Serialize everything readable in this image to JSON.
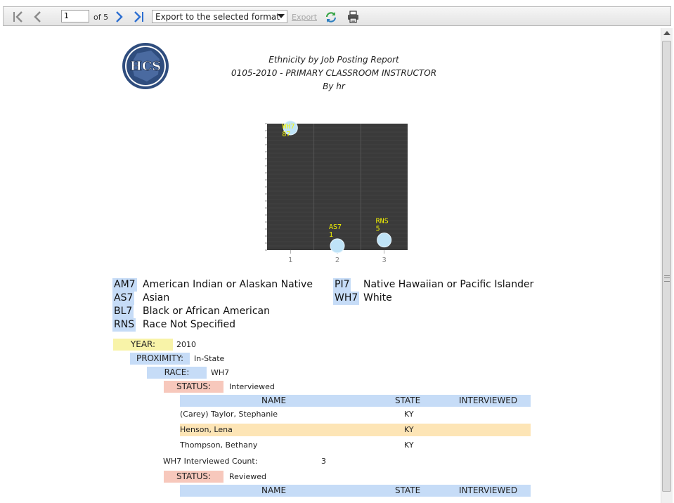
{
  "toolbar": {
    "page_value": "1",
    "page_of": "of 5",
    "export_format": "Export to the selected format",
    "export_label": "Export"
  },
  "report": {
    "logo_text": "HCS",
    "title": "Ethnicity by Job Posting Report",
    "subtitle": "0105-2010 - PRIMARY CLASSROOM INSTRUCTOR",
    "by": "By hr"
  },
  "chart_data": {
    "type": "scatter",
    "x_ticks": [
      "1",
      "2",
      "3"
    ],
    "points": [
      {
        "x": 1,
        "y": 87,
        "code": "WH7",
        "value": "87"
      },
      {
        "x": 2,
        "y": 1,
        "code": "AS7",
        "value": "1"
      },
      {
        "x": 3,
        "y": 5,
        "code": "RNS",
        "value": "5"
      }
    ],
    "ylim": [
      0,
      87
    ],
    "background": "#3a3a3a",
    "point_color": "#bfe3f7",
    "label_color": "#f5f500"
  },
  "legend": [
    {
      "code": "AM7",
      "desc": "American Indian or Alaskan Native"
    },
    {
      "code": "AS7",
      "desc": "Asian"
    },
    {
      "code": "BL7",
      "desc": "Black or African American"
    },
    {
      "code": "RNS",
      "desc": "Race Not Specified"
    },
    {
      "code": "PI7",
      "desc": "Native Hawaiian or Pacific Islander"
    },
    {
      "code": "WH7",
      "desc": "White"
    }
  ],
  "groups": {
    "year_label": "YEAR:",
    "year_value": "2010",
    "proximity_label": "PROXIMITY:",
    "proximity_value": "In-State",
    "race_label": "RACE:",
    "race_value": "WH7",
    "status_label": "STATUS:",
    "status1_value": "Interviewed",
    "status2_value": "Reviewed",
    "count_label": "WH7 Interviewed Count:",
    "count_value": "3"
  },
  "table": {
    "headers": [
      "NAME",
      "STATE",
      "INTERVIEWED"
    ],
    "rows": [
      {
        "name": "(Carey) Taylor, Stephanie",
        "state": "KY"
      },
      {
        "name": "Henson, Lena",
        "state": "KY"
      },
      {
        "name": "Thompson, Bethany",
        "state": "KY"
      }
    ]
  },
  "colors": {
    "header_blue": "#c6dcf7",
    "year_yellow": "#f8f3a8",
    "status_red": "#f7c8bc",
    "row_highlight": "#fde5b6"
  }
}
